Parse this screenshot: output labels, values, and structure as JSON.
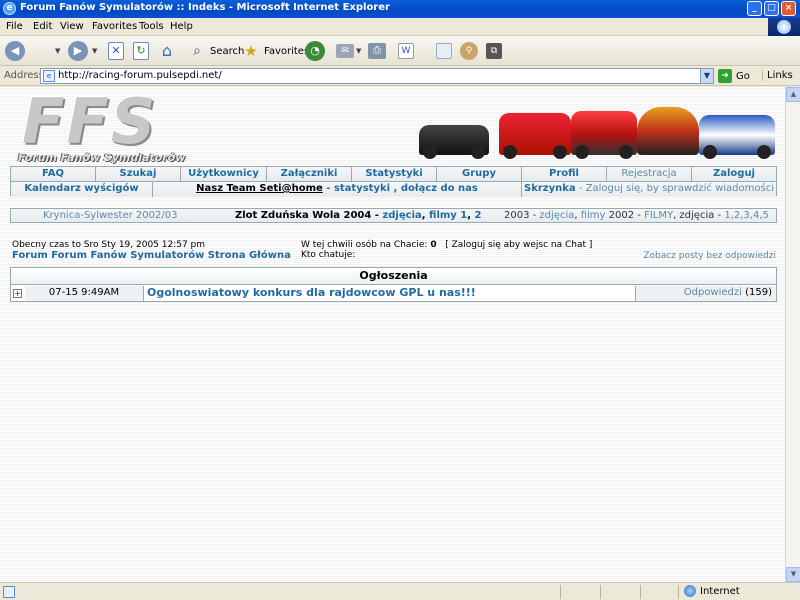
{
  "window": {
    "title": "Forum Fanów Symulatorów :: Indeks - Microsoft Internet Explorer"
  },
  "menu": [
    "File",
    "Edit",
    "View",
    "Favorites",
    "Tools",
    "Help"
  ],
  "toolbar": {
    "search_label": "Search",
    "favorites_label": "Favorites"
  },
  "address": {
    "label": "Address",
    "url": "http://racing-forum.pulsepdi.net/",
    "go_label": "Go",
    "links_label": "Links"
  },
  "header": {
    "logo_text": "FFS",
    "logo_subtitle": "Forum Fanów Symulatorów"
  },
  "nav": {
    "row1": [
      "FAQ",
      "Szukaj",
      "Użytkownicy",
      "Załączniki",
      "Statystyki",
      "Grupy",
      "Profil",
      "Rejestracja",
      "Zaloguj"
    ],
    "calendar": "Kalendarz wyścigów",
    "team_link": "Nasz Team Seti@home",
    "team_sep": " - ",
    "team_stats": "statystyki",
    "team_comma": " , ",
    "team_join": "dołącz do nas",
    "inbox": "Skrzynka",
    "inbox_msg": " - Zaloguj się, by sprawdzić wiadomości"
  },
  "events": {
    "left": "Krynica-Sylwester 2002/03",
    "middle_title": "Zlot Zduńska Wola 2004",
    "middle_sep1": " - ",
    "middle_photos": "zdjęcia",
    "middle_comma": ", ",
    "middle_films": "filmy 1",
    "middle_comma2": ", ",
    "middle_two": "2",
    "right_2003": "2003 - ",
    "right_photos": "zdjęcia",
    "right_comma": ", ",
    "right_films": "filmy",
    "right_2002": " 2002 - ",
    "right_filmy": "FILMY",
    "right_z": ", zdjęcia - ",
    "right_nums": "1,2,3,4,5"
  },
  "info": {
    "time": "Obecny czas to Sro Sty 19, 2005 12:57 pm",
    "forum_index": "Forum Forum Fanów Symulatorów Strona Główna",
    "chat_count_label": "W tej chwili osób na Chacie:",
    "chat_count": "0",
    "chat_login": "[ Zaloguj się aby wejsc na Chat ]",
    "chatting_label": "Kto chatuje:",
    "unanswered": "Zobacz posty bez odpowiedzi"
  },
  "announcements": {
    "header": "Ogłoszenia",
    "rows": [
      {
        "expand": "+",
        "date": "07-15 9:49AM",
        "topic": "Ogolnoswiatowy konkurs dla rajdowcow GPL u nas!!!",
        "replies_label": "Odpowiedzi",
        "replies_count": "(159)"
      }
    ]
  },
  "status": {
    "zone": "Internet"
  },
  "colors": {
    "link": "#1f6ba0",
    "link_light": "#5a8aa8",
    "border": "#98aab1",
    "titlebar": "#0448c5"
  }
}
